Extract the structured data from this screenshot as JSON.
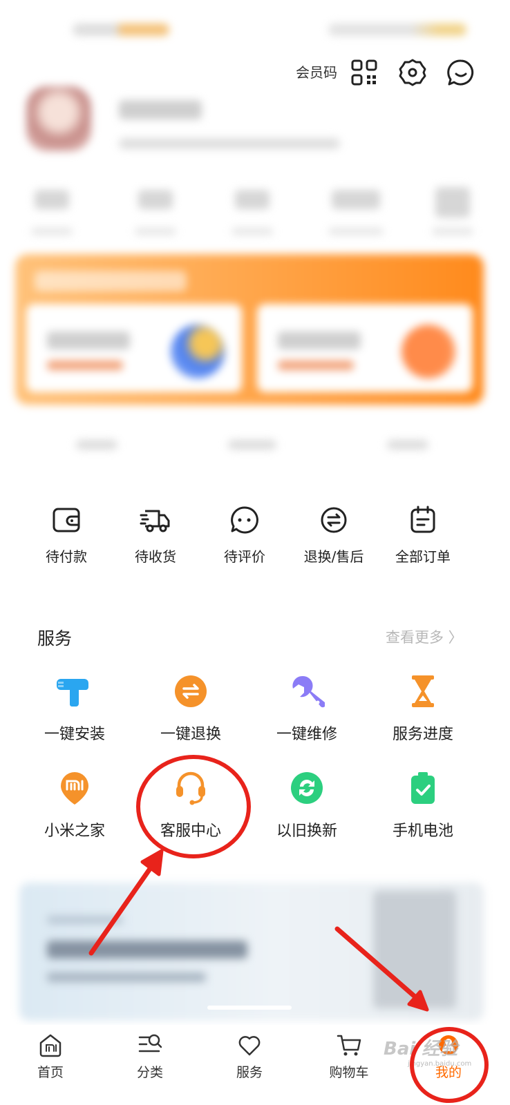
{
  "header": {
    "member_code_label": "会员码"
  },
  "orders": [
    {
      "label": "待付款",
      "icon": "wallet-icon"
    },
    {
      "label": "待收货",
      "icon": "delivery-truck-icon"
    },
    {
      "label": "待评价",
      "icon": "comment-icon"
    },
    {
      "label": "退换/售后",
      "icon": "exchange-icon"
    },
    {
      "label": "全部订单",
      "icon": "order-list-icon"
    }
  ],
  "services": {
    "title": "服务",
    "more_label": "查看更多 〉",
    "items": [
      {
        "label": "一键安装",
        "icon": "install-drill-icon",
        "color": "#2aa6f0"
      },
      {
        "label": "一键退换",
        "icon": "exchange-circle-icon",
        "color": "#f5922a"
      },
      {
        "label": "一键维修",
        "icon": "wrench-icon",
        "color": "#8b7cf6"
      },
      {
        "label": "服务进度",
        "icon": "hourglass-icon",
        "color": "#f5922a"
      },
      {
        "label": "小米之家",
        "icon": "mi-store-pin-icon",
        "color": "#f5922a"
      },
      {
        "label": "客服中心",
        "icon": "headset-icon",
        "color": "#f5922a"
      },
      {
        "label": "以旧换新",
        "icon": "trade-in-icon",
        "color": "#2ccf7f"
      },
      {
        "label": "手机电池",
        "icon": "battery-icon",
        "color": "#2ccf7f"
      }
    ]
  },
  "bottom_nav": [
    {
      "label": "首页",
      "icon": "home-icon"
    },
    {
      "label": "分类",
      "icon": "category-icon"
    },
    {
      "label": "服务",
      "icon": "heart-icon"
    },
    {
      "label": "购物车",
      "icon": "cart-icon"
    },
    {
      "label": "我的",
      "icon": "profile-icon",
      "active": true
    }
  ],
  "watermark": {
    "brand": "Bai 经验",
    "url": "jingyan.baidu.com"
  },
  "colors": {
    "accent": "#ff6a00",
    "annotation": "#e8231b"
  }
}
